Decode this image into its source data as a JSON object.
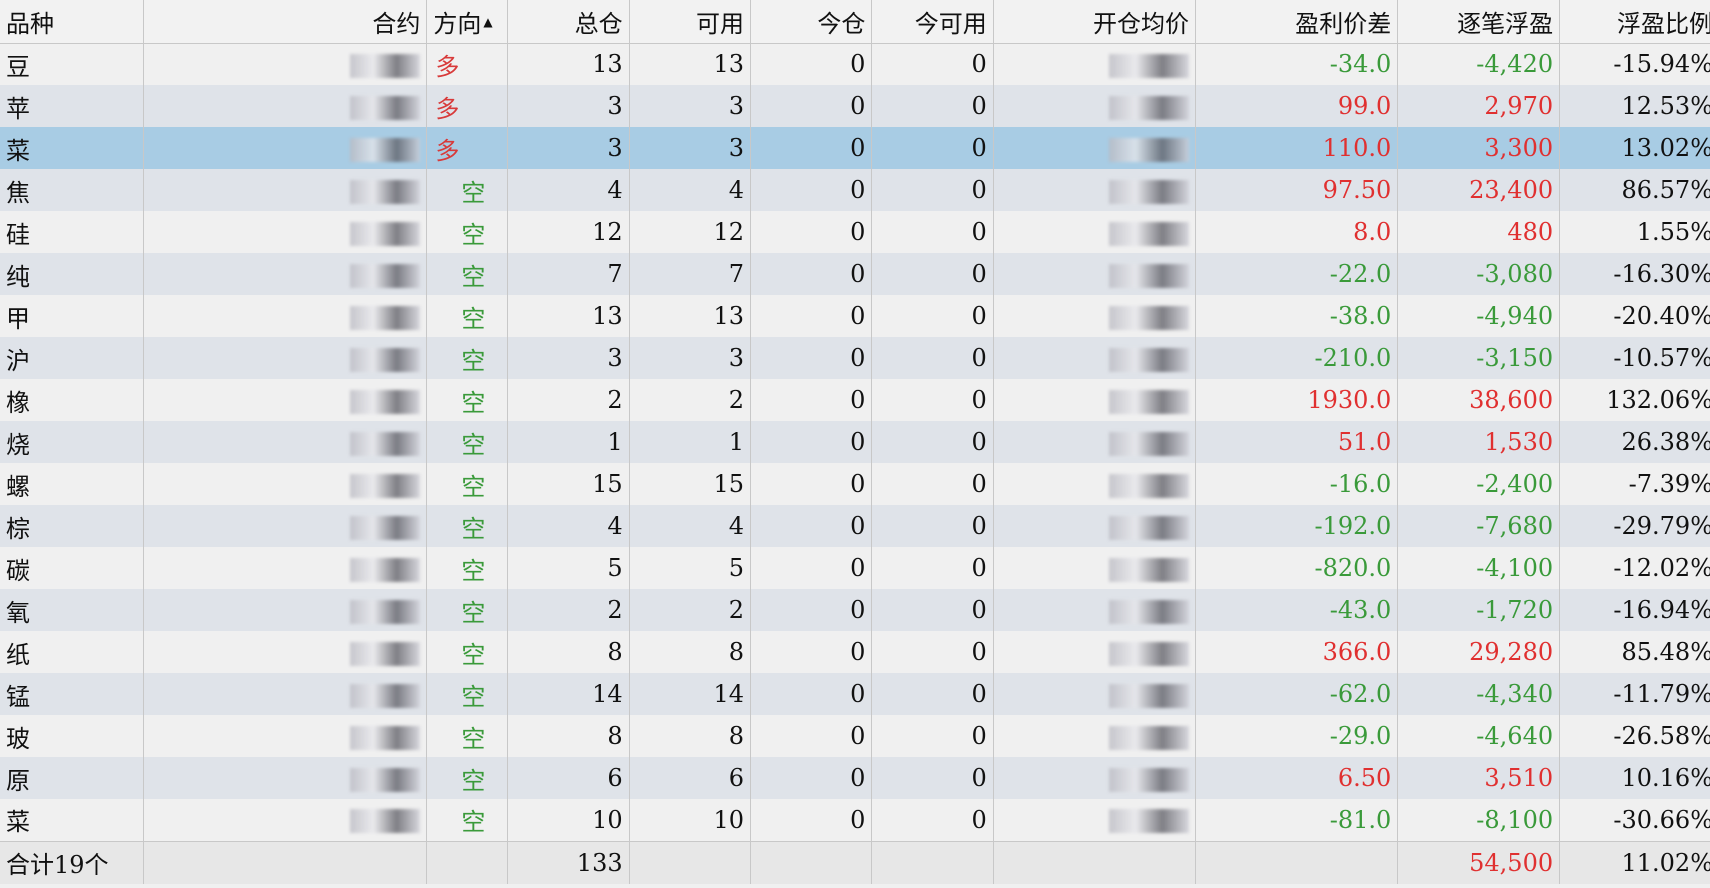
{
  "columns": {
    "product": "品种",
    "contract": "合约",
    "direction": "方向",
    "total": "总仓",
    "available": "可用",
    "today": "今仓",
    "today_available": "今可用",
    "open_avg": "开仓均价",
    "pnl_diff": "盈利价差",
    "float_pnl": "逐笔浮盈",
    "float_ratio": "浮盈比例"
  },
  "sort_indicator": "▲",
  "rows": [
    {
      "product": "豆",
      "direction": "多",
      "dir_type": "long",
      "total": "13",
      "available": "13",
      "today": "0",
      "today_available": "0",
      "pnl_diff": "-34.0",
      "float_pnl": "-4,420",
      "float_ratio": "-15.94%",
      "sign": "neg"
    },
    {
      "product": "苹",
      "direction": "多",
      "dir_type": "long",
      "total": "3",
      "available": "3",
      "today": "0",
      "today_available": "0",
      "pnl_diff": "99.0",
      "float_pnl": "2,970",
      "float_ratio": "12.53%",
      "sign": "pos"
    },
    {
      "product": "菜",
      "direction": "多",
      "dir_type": "long",
      "total": "3",
      "available": "3",
      "today": "0",
      "today_available": "0",
      "pnl_diff": "110.0",
      "float_pnl": "3,300",
      "float_ratio": "13.02%",
      "sign": "pos",
      "selected": true
    },
    {
      "product": "焦",
      "direction": "空",
      "dir_type": "short",
      "total": "4",
      "available": "4",
      "today": "0",
      "today_available": "0",
      "pnl_diff": "97.50",
      "float_pnl": "23,400",
      "float_ratio": "86.57%",
      "sign": "pos"
    },
    {
      "product": "硅",
      "direction": "空",
      "dir_type": "short",
      "total": "12",
      "available": "12",
      "today": "0",
      "today_available": "0",
      "pnl_diff": "8.0",
      "float_pnl": "480",
      "float_ratio": "1.55%",
      "sign": "pos"
    },
    {
      "product": "纯",
      "direction": "空",
      "dir_type": "short",
      "total": "7",
      "available": "7",
      "today": "0",
      "today_available": "0",
      "pnl_diff": "-22.0",
      "float_pnl": "-3,080",
      "float_ratio": "-16.30%",
      "sign": "neg"
    },
    {
      "product": "甲",
      "direction": "空",
      "dir_type": "short",
      "total": "13",
      "available": "13",
      "today": "0",
      "today_available": "0",
      "pnl_diff": "-38.0",
      "float_pnl": "-4,940",
      "float_ratio": "-20.40%",
      "sign": "neg"
    },
    {
      "product": "沪",
      "direction": "空",
      "dir_type": "short",
      "total": "3",
      "available": "3",
      "today": "0",
      "today_available": "0",
      "pnl_diff": "-210.0",
      "float_pnl": "-3,150",
      "float_ratio": "-10.57%",
      "sign": "neg"
    },
    {
      "product": "橡",
      "direction": "空",
      "dir_type": "short",
      "total": "2",
      "available": "2",
      "today": "0",
      "today_available": "0",
      "pnl_diff": "1930.0",
      "float_pnl": "38,600",
      "float_ratio": "132.06%",
      "sign": "pos"
    },
    {
      "product": "烧",
      "direction": "空",
      "dir_type": "short",
      "total": "1",
      "available": "1",
      "today": "0",
      "today_available": "0",
      "pnl_diff": "51.0",
      "float_pnl": "1,530",
      "float_ratio": "26.38%",
      "sign": "pos"
    },
    {
      "product": "螺",
      "direction": "空",
      "dir_type": "short",
      "total": "15",
      "available": "15",
      "today": "0",
      "today_available": "0",
      "pnl_diff": "-16.0",
      "float_pnl": "-2,400",
      "float_ratio": "-7.39%",
      "sign": "neg"
    },
    {
      "product": "棕",
      "direction": "空",
      "dir_type": "short",
      "total": "4",
      "available": "4",
      "today": "0",
      "today_available": "0",
      "pnl_diff": "-192.0",
      "float_pnl": "-7,680",
      "float_ratio": "-29.79%",
      "sign": "neg"
    },
    {
      "product": "碳",
      "direction": "空",
      "dir_type": "short",
      "total": "5",
      "available": "5",
      "today": "0",
      "today_available": "0",
      "pnl_diff": "-820.0",
      "float_pnl": "-4,100",
      "float_ratio": "-12.02%",
      "sign": "neg"
    },
    {
      "product": "氧",
      "direction": "空",
      "dir_type": "short",
      "total": "2",
      "available": "2",
      "today": "0",
      "today_available": "0",
      "pnl_diff": "-43.0",
      "float_pnl": "-1,720",
      "float_ratio": "-16.94%",
      "sign": "neg"
    },
    {
      "product": "纸",
      "direction": "空",
      "dir_type": "short",
      "total": "8",
      "available": "8",
      "today": "0",
      "today_available": "0",
      "pnl_diff": "366.0",
      "float_pnl": "29,280",
      "float_ratio": "85.48%",
      "sign": "pos"
    },
    {
      "product": "锰",
      "direction": "空",
      "dir_type": "short",
      "total": "14",
      "available": "14",
      "today": "0",
      "today_available": "0",
      "pnl_diff": "-62.0",
      "float_pnl": "-4,340",
      "float_ratio": "-11.79%",
      "sign": "neg"
    },
    {
      "product": "玻",
      "direction": "空",
      "dir_type": "short",
      "total": "8",
      "available": "8",
      "today": "0",
      "today_available": "0",
      "pnl_diff": "-29.0",
      "float_pnl": "-4,640",
      "float_ratio": "-26.58%",
      "sign": "neg"
    },
    {
      "product": "原",
      "direction": "空",
      "dir_type": "short",
      "total": "6",
      "available": "6",
      "today": "0",
      "today_available": "0",
      "pnl_diff": "6.50",
      "float_pnl": "3,510",
      "float_ratio": "10.16%",
      "sign": "pos"
    },
    {
      "product": "菜",
      "direction": "空",
      "dir_type": "short",
      "total": "10",
      "available": "10",
      "today": "0",
      "today_available": "0",
      "pnl_diff": "-81.0",
      "float_pnl": "-8,100",
      "float_ratio": "-30.66%",
      "sign": "neg"
    }
  ],
  "footer": {
    "label": "合计19个",
    "total": "133",
    "float_pnl": "54,500",
    "float_ratio": "11.02%"
  },
  "colors": {
    "profit": "#e03030",
    "loss": "#3a9a3a",
    "selected_row": "#a8cce4",
    "alt_row": "#dfe3e9"
  }
}
